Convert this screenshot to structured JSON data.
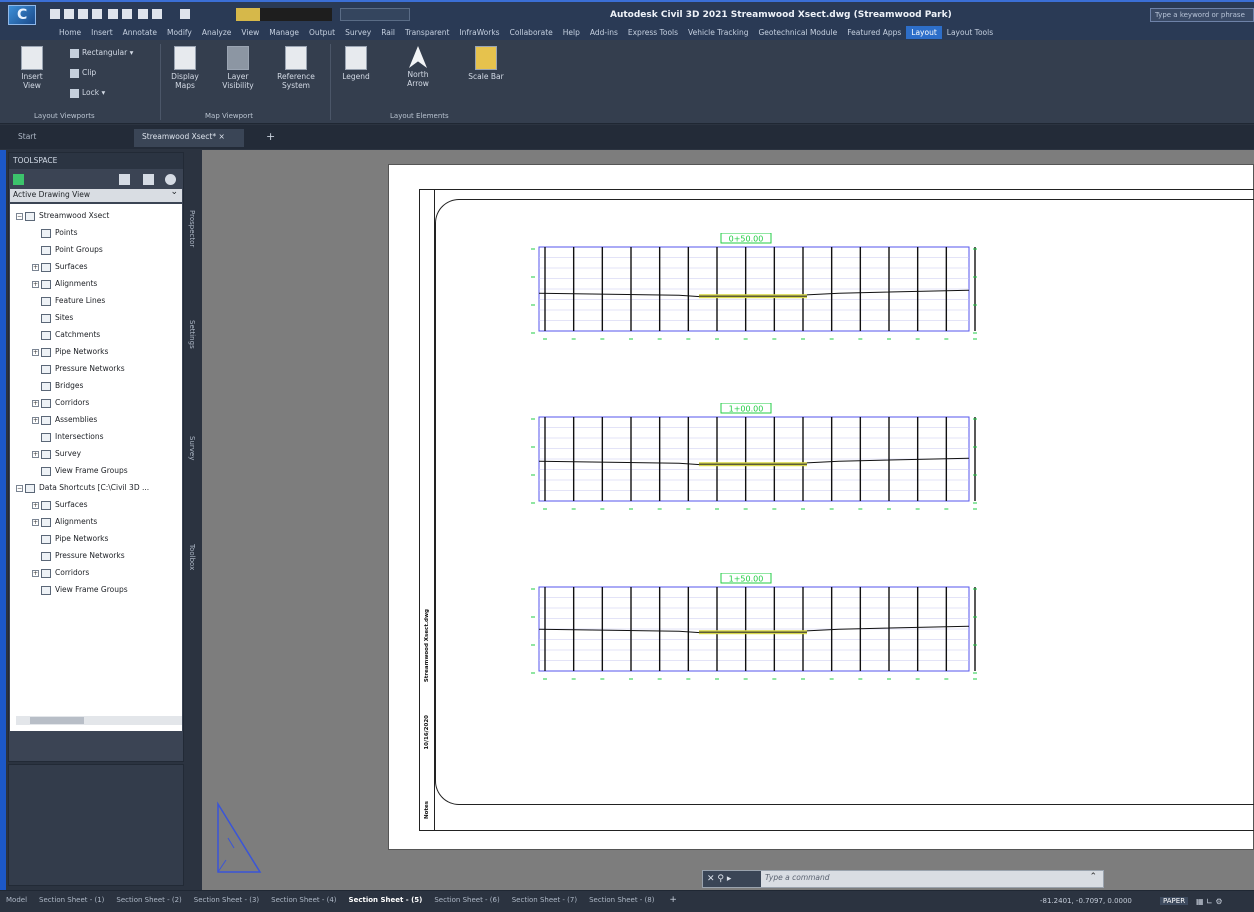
{
  "titlebar": {
    "title": "Autodesk Civil 3D 2021   Streamwood Xsect.dwg (Streamwood Park)",
    "search_placeholder": "Type a keyword or phrase"
  },
  "ribbon_tabs": [
    "Home",
    "Insert",
    "Annotate",
    "Modify",
    "Analyze",
    "View",
    "Manage",
    "Output",
    "Survey",
    "Rail",
    "Transparent",
    "InfraWorks",
    "Collaborate",
    "Help",
    "Add-ins",
    "Express Tools",
    "Vehicle Tracking",
    "Geotechnical Module",
    "Featured Apps",
    "Layout",
    "Layout Tools"
  ],
  "ribbon_active_tab": "Layout",
  "ribbon": {
    "insert_view": "Insert View",
    "rectangular": "Rectangular",
    "clip": "Clip",
    "lock": "Lock",
    "display_maps": "Display Maps",
    "layer_visibility": "Layer Visibility",
    "reference_system": "Reference System",
    "legend": "Legend",
    "north_arrow": "North Arrow",
    "scale_bar": "Scale Bar",
    "panel_layout_viewports": "Layout Viewports",
    "panel_map_viewport": "Map Viewport",
    "panel_layout_elements": "Layout Elements"
  },
  "doc_tabs": {
    "start": "Start",
    "drawing": "Streamwood Xsect*",
    "close": "×",
    "add": "+"
  },
  "toolspace": {
    "title": "TOOLSPACE",
    "view_dropdown": "Active Drawing View",
    "tree": [
      {
        "label": "Streamwood Xsect",
        "indent": 0,
        "exp": "−"
      },
      {
        "label": "Points",
        "indent": 1,
        "exp": ""
      },
      {
        "label": "Point Groups",
        "indent": 1,
        "exp": ""
      },
      {
        "label": "Surfaces",
        "indent": 1,
        "exp": "+"
      },
      {
        "label": "Alignments",
        "indent": 1,
        "exp": "+"
      },
      {
        "label": "Feature Lines",
        "indent": 1,
        "exp": ""
      },
      {
        "label": "Sites",
        "indent": 1,
        "exp": ""
      },
      {
        "label": "Catchments",
        "indent": 1,
        "exp": ""
      },
      {
        "label": "Pipe Networks",
        "indent": 1,
        "exp": "+"
      },
      {
        "label": "Pressure Networks",
        "indent": 1,
        "exp": ""
      },
      {
        "label": "Bridges",
        "indent": 1,
        "exp": ""
      },
      {
        "label": "Corridors",
        "indent": 1,
        "exp": "+"
      },
      {
        "label": "Assemblies",
        "indent": 1,
        "exp": "+"
      },
      {
        "label": "Intersections",
        "indent": 1,
        "exp": ""
      },
      {
        "label": "Survey",
        "indent": 1,
        "exp": "+"
      },
      {
        "label": "View Frame Groups",
        "indent": 1,
        "exp": ""
      },
      {
        "label": "Data Shortcuts [C:\\Civil 3D ...",
        "indent": 0,
        "exp": "−"
      },
      {
        "label": "Surfaces",
        "indent": 1,
        "exp": "+"
      },
      {
        "label": "Alignments",
        "indent": 1,
        "exp": "+"
      },
      {
        "label": "Pipe Networks",
        "indent": 1,
        "exp": ""
      },
      {
        "label": "Pressure Networks",
        "indent": 1,
        "exp": ""
      },
      {
        "label": "Corridors",
        "indent": 1,
        "exp": "+"
      },
      {
        "label": "View Frame Groups",
        "indent": 1,
        "exp": ""
      }
    ]
  },
  "side_tabs": [
    "Prospector",
    "Settings",
    "Survey",
    "Toolbox"
  ],
  "sheet_strip": [
    "Streamwood Xsect.dwg",
    "10/16/2020",
    "Notes"
  ],
  "sections": [
    {
      "label": "0+50.00"
    },
    {
      "label": "1+00.00"
    },
    {
      "label": "1+50.00"
    }
  ],
  "command_line": {
    "placeholder": "Type a command"
  },
  "layout_tabs": [
    "Model",
    "Section Sheet - (1)",
    "Section Sheet - (2)",
    "Section Sheet - (3)",
    "Section Sheet - (4)",
    "Section Sheet - (5)",
    "Section Sheet - (6)",
    "Section Sheet - (7)",
    "Section Sheet - (8)"
  ],
  "active_layout_tab": "Section Sheet - (5)",
  "status": {
    "coords": "-81.2401, -0.7097, 0.0000",
    "mode": "PAPER"
  },
  "colors": {
    "accent": "#2d6ec9",
    "grid_line": "#5555ee",
    "label_green": "#22cc44",
    "ground_yellow": "#d8d84a"
  }
}
